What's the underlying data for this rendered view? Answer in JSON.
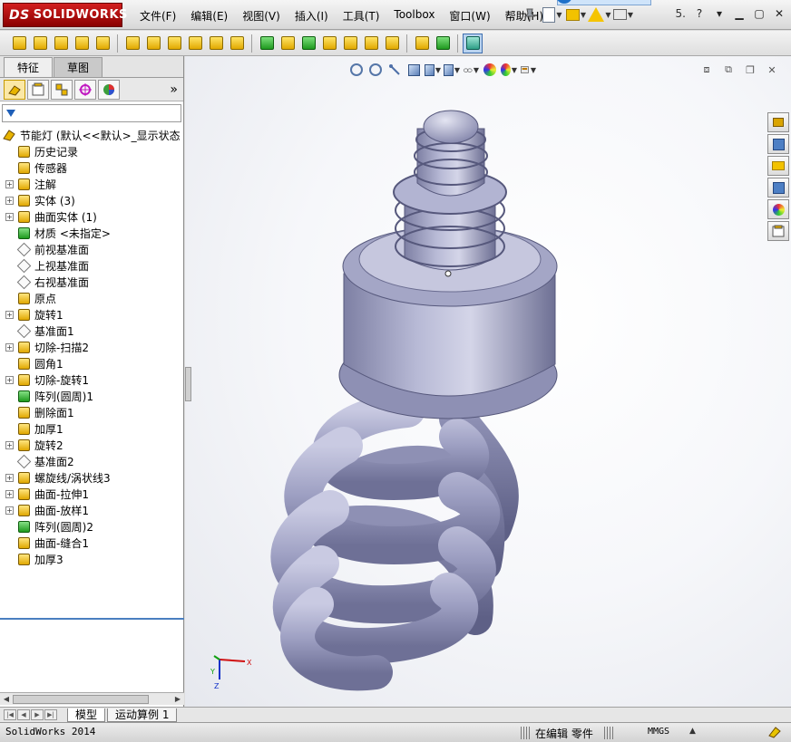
{
  "app": {
    "logo_ds": "DS",
    "logo_text": "SOLIDWORKS",
    "menu": [
      "文件(F)",
      "编辑(E)",
      "视图(V)",
      "插入(I)",
      "工具(T)",
      "Toolbox",
      "窗口(W)",
      "帮助(H)"
    ],
    "help_glyph": "5."
  },
  "left_tabs": [
    "特征",
    "草图"
  ],
  "tree": {
    "root": "节能灯  (默认<<默认>_显示状态",
    "items": [
      {
        "label": "历史记录",
        "exp": false,
        "icon": "history-icon"
      },
      {
        "label": "传感器",
        "exp": false,
        "icon": "sensor-icon"
      },
      {
        "label": "注解",
        "exp": true,
        "icon": "annotation-icon"
      },
      {
        "label": "实体 (3)",
        "exp": true,
        "icon": "solid-bodies-icon"
      },
      {
        "label": "曲面实体 (1)",
        "exp": true,
        "icon": "surface-bodies-icon"
      },
      {
        "label": "材质 <未指定>",
        "exp": false,
        "icon": "material-icon"
      },
      {
        "label": "前视基准面",
        "exp": false,
        "icon": "plane-icon"
      },
      {
        "label": "上视基准面",
        "exp": false,
        "icon": "plane-icon"
      },
      {
        "label": "右视基准面",
        "exp": false,
        "icon": "plane-icon"
      },
      {
        "label": "原点",
        "exp": false,
        "icon": "origin-icon"
      },
      {
        "label": "旋转1",
        "exp": true,
        "icon": "revolve-icon"
      },
      {
        "label": "基准面1",
        "exp": false,
        "icon": "plane-icon"
      },
      {
        "label": "切除-扫描2",
        "exp": true,
        "icon": "cut-sweep-icon"
      },
      {
        "label": "圆角1",
        "exp": false,
        "icon": "fillet-icon"
      },
      {
        "label": "切除-旋转1",
        "exp": true,
        "icon": "cut-revolve-icon"
      },
      {
        "label": "阵列(圆周)1",
        "exp": false,
        "icon": "circular-pattern-icon"
      },
      {
        "label": "删除面1",
        "exp": false,
        "icon": "delete-face-icon"
      },
      {
        "label": "加厚1",
        "exp": false,
        "icon": "thicken-icon"
      },
      {
        "label": "旋转2",
        "exp": true,
        "icon": "revolve-icon"
      },
      {
        "label": "基准面2",
        "exp": false,
        "icon": "plane-icon"
      },
      {
        "label": "螺旋线/涡状线3",
        "exp": true,
        "icon": "helix-icon"
      },
      {
        "label": "曲面-拉伸1",
        "exp": true,
        "icon": "surface-extrude-icon"
      },
      {
        "label": "曲面-放样1",
        "exp": true,
        "icon": "surface-loft-icon"
      },
      {
        "label": "阵列(圆周)2",
        "exp": false,
        "icon": "circular-pattern-icon"
      },
      {
        "label": "曲面-缝合1",
        "exp": false,
        "icon": "knit-icon"
      },
      {
        "label": "加厚3",
        "exp": false,
        "icon": "thicken-icon"
      }
    ]
  },
  "bottom_tabs": [
    "模型",
    "运动算例 1"
  ],
  "status": {
    "left": "SolidWorks 2014",
    "mode": "在编辑 零件",
    "units": "MMGS"
  },
  "triad": {
    "x": "X",
    "y": "Y",
    "z": "Z"
  },
  "colors": {
    "accent": "#4a7ec0",
    "model": "#a9abc8"
  }
}
